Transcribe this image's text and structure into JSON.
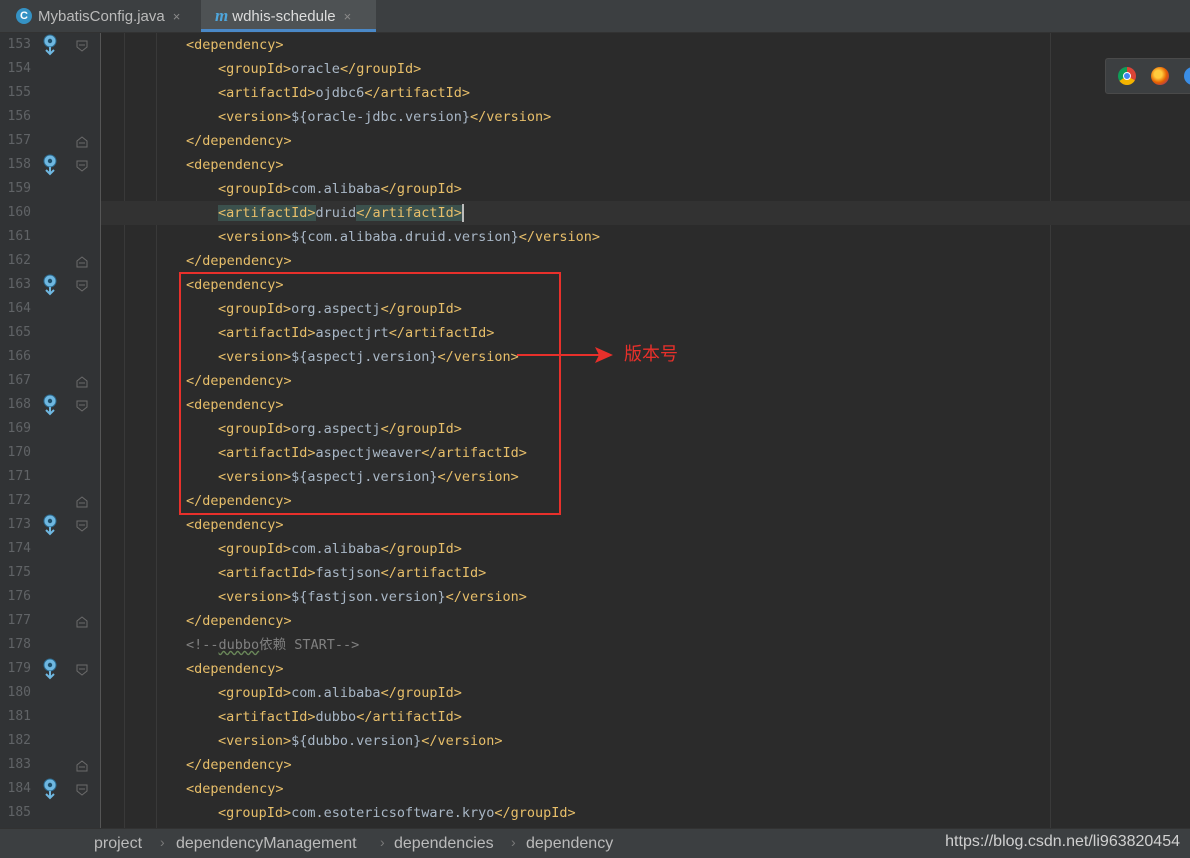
{
  "tabs": [
    {
      "icon": "c-class-icon",
      "icon_text": "C",
      "label": "MybatisConfig.java",
      "close": "×"
    },
    {
      "icon": "maven-icon",
      "icon_text": "m",
      "label": "wdhis-schedule",
      "close": "×"
    }
  ],
  "editor": {
    "lines": [
      {
        "n": "153",
        "indent": 1,
        "marker": true,
        "fold": "open",
        "tokens": [
          [
            "tag",
            "<dependency>"
          ]
        ]
      },
      {
        "n": "154",
        "indent": 2,
        "tokens": [
          [
            "tag",
            "<groupId>"
          ],
          [
            "txt",
            "oracle"
          ],
          [
            "tag",
            "</groupId>"
          ]
        ]
      },
      {
        "n": "155",
        "indent": 2,
        "tokens": [
          [
            "tag",
            "<artifactId>"
          ],
          [
            "txt",
            "ojdbc6"
          ],
          [
            "tag",
            "</artifactId>"
          ]
        ]
      },
      {
        "n": "156",
        "indent": 2,
        "tokens": [
          [
            "tag",
            "<version>"
          ],
          [
            "txt",
            "${oracle-jdbc.version}"
          ],
          [
            "tag",
            "</version>"
          ]
        ]
      },
      {
        "n": "157",
        "indent": 1,
        "fold": "close",
        "tokens": [
          [
            "tag",
            "</dependency>"
          ]
        ]
      },
      {
        "n": "158",
        "indent": 1,
        "marker": true,
        "fold": "open",
        "tokens": [
          [
            "tag",
            "<dependency>"
          ]
        ]
      },
      {
        "n": "159",
        "indent": 2,
        "tokens": [
          [
            "tag",
            "<groupId>"
          ],
          [
            "txt",
            "com.alibaba"
          ],
          [
            "tag",
            "</groupId>"
          ]
        ]
      },
      {
        "n": "160",
        "indent": 2,
        "current": true,
        "tokens": [
          [
            "tagmatch",
            "<artifactId>"
          ],
          [
            "txt",
            "druid"
          ],
          [
            "tagmatch",
            "</artifactId>"
          ],
          [
            "caret",
            ""
          ]
        ]
      },
      {
        "n": "161",
        "indent": 2,
        "tokens": [
          [
            "tag",
            "<version>"
          ],
          [
            "txt",
            "${com.alibaba.druid.version}"
          ],
          [
            "tag",
            "</version>"
          ]
        ]
      },
      {
        "n": "162",
        "indent": 1,
        "fold": "close",
        "tokens": [
          [
            "tag",
            "</dependency>"
          ]
        ]
      },
      {
        "n": "163",
        "indent": 1,
        "marker": true,
        "fold": "open",
        "tokens": [
          [
            "tag",
            "<dependency>"
          ]
        ]
      },
      {
        "n": "164",
        "indent": 2,
        "tokens": [
          [
            "tag",
            "<groupId>"
          ],
          [
            "txt",
            "org.aspectj"
          ],
          [
            "tag",
            "</groupId>"
          ]
        ]
      },
      {
        "n": "165",
        "indent": 2,
        "tokens": [
          [
            "tag",
            "<artifactId>"
          ],
          [
            "txt",
            "aspectjrt"
          ],
          [
            "tag",
            "</artifactId>"
          ]
        ]
      },
      {
        "n": "166",
        "indent": 2,
        "tokens": [
          [
            "tag",
            "<version>"
          ],
          [
            "txt",
            "${aspectj.version}"
          ],
          [
            "tag",
            "</version>"
          ]
        ]
      },
      {
        "n": "167",
        "indent": 1,
        "fold": "close",
        "tokens": [
          [
            "tag",
            "</dependency>"
          ]
        ]
      },
      {
        "n": "168",
        "indent": 1,
        "marker": true,
        "fold": "open",
        "tokens": [
          [
            "tag",
            "<dependency>"
          ]
        ]
      },
      {
        "n": "169",
        "indent": 2,
        "tokens": [
          [
            "tag",
            "<groupId>"
          ],
          [
            "txt",
            "org.aspectj"
          ],
          [
            "tag",
            "</groupId>"
          ]
        ]
      },
      {
        "n": "170",
        "indent": 2,
        "tokens": [
          [
            "tag",
            "<artifactId>"
          ],
          [
            "txt",
            "aspectjweaver"
          ],
          [
            "tag",
            "</artifactId>"
          ]
        ]
      },
      {
        "n": "171",
        "indent": 2,
        "tokens": [
          [
            "tag",
            "<version>"
          ],
          [
            "txt",
            "${aspectj.version}"
          ],
          [
            "tag",
            "</version>"
          ]
        ]
      },
      {
        "n": "172",
        "indent": 1,
        "fold": "close",
        "tokens": [
          [
            "tag",
            "</dependency>"
          ]
        ]
      },
      {
        "n": "173",
        "indent": 1,
        "marker": true,
        "fold": "open",
        "tokens": [
          [
            "tag",
            "<dependency>"
          ]
        ]
      },
      {
        "n": "174",
        "indent": 2,
        "tokens": [
          [
            "tag",
            "<groupId>"
          ],
          [
            "txt",
            "com.alibaba"
          ],
          [
            "tag",
            "</groupId>"
          ]
        ]
      },
      {
        "n": "175",
        "indent": 2,
        "tokens": [
          [
            "tag",
            "<artifactId>"
          ],
          [
            "txt",
            "fastjson"
          ],
          [
            "tag",
            "</artifactId>"
          ]
        ]
      },
      {
        "n": "176",
        "indent": 2,
        "tokens": [
          [
            "tag",
            "<version>"
          ],
          [
            "txt",
            "${fastjson.version}"
          ],
          [
            "tag",
            "</version>"
          ]
        ]
      },
      {
        "n": "177",
        "indent": 1,
        "fold": "close",
        "tokens": [
          [
            "tag",
            "</dependency>"
          ]
        ]
      },
      {
        "n": "178",
        "indent": 1,
        "tokens": [
          [
            "cmt",
            "<!--"
          ],
          [
            "cmtw",
            "dubbo"
          ],
          [
            "cmt",
            "依赖 START-->"
          ]
        ]
      },
      {
        "n": "179",
        "indent": 1,
        "marker": true,
        "fold": "open",
        "tokens": [
          [
            "tag",
            "<dependency>"
          ]
        ]
      },
      {
        "n": "180",
        "indent": 2,
        "tokens": [
          [
            "tag",
            "<groupId>"
          ],
          [
            "txt",
            "com.alibaba"
          ],
          [
            "tag",
            "</groupId>"
          ]
        ]
      },
      {
        "n": "181",
        "indent": 2,
        "tokens": [
          [
            "tag",
            "<artifactId>"
          ],
          [
            "txt",
            "dubbo"
          ],
          [
            "tag",
            "</artifactId>"
          ]
        ]
      },
      {
        "n": "182",
        "indent": 2,
        "tokens": [
          [
            "tag",
            "<version>"
          ],
          [
            "txt",
            "${dubbo.version}"
          ],
          [
            "tag",
            "</version>"
          ]
        ]
      },
      {
        "n": "183",
        "indent": 1,
        "fold": "close",
        "tokens": [
          [
            "tag",
            "</dependency>"
          ]
        ]
      },
      {
        "n": "184",
        "indent": 1,
        "marker": true,
        "fold": "open",
        "tokens": [
          [
            "tag",
            "<dependency>"
          ]
        ]
      },
      {
        "n": "185",
        "indent": 2,
        "tokens": [
          [
            "tag",
            "<groupId>"
          ],
          [
            "txt",
            "com.esotericsoftware.kryo"
          ],
          [
            "tag",
            "</groupId>"
          ]
        ]
      }
    ]
  },
  "annotation": {
    "label": "版本号",
    "color": "#e8302b"
  },
  "browser_icons": [
    "chrome-icon",
    "firefox-icon",
    "ie-icon"
  ],
  "breadcrumb": [
    "project",
    "dependencyManagement",
    "dependencies",
    "dependency"
  ],
  "watermark": "https://blog.csdn.net/li963820454",
  "colors": {
    "tag": "#e8bf6a",
    "text": "#a9b7c6",
    "comment": "#808080",
    "background": "#2b2b2b"
  }
}
